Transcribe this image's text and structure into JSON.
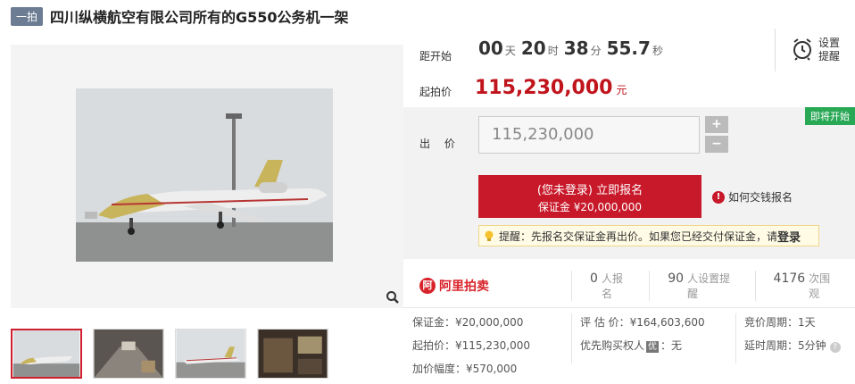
{
  "header": {
    "round_badge": "一拍",
    "title": "四川纵横航空有限公司所有的G550公务机一架"
  },
  "countdown": {
    "label": "距开始",
    "days": "00",
    "days_unit": "天",
    "hours": "20",
    "hours_unit": "时",
    "minutes": "38",
    "minutes_unit": "分",
    "seconds": "55.7",
    "seconds_unit": "秒"
  },
  "remind": {
    "line1": "设置",
    "line2": "提醒"
  },
  "start_price": {
    "label": "起拍价",
    "value": "115,230,000",
    "unit": "元"
  },
  "bid": {
    "soon_tag": "即将开始",
    "label": "出 价",
    "input_value": "115,230,000",
    "plus": "+",
    "minus": "−",
    "signup_main": "(您未登录) 立即报名",
    "signup_sub": "保证金 ¥20,000,000",
    "howto": "如何交钱报名",
    "tip_text": "提醒：先报名交保证金再出价。如果您已经交付保证金，请",
    "tip_link": "登录"
  },
  "stats": {
    "logo_text": "阿里拍卖",
    "signups_num": "0",
    "signups_unit": "人报名",
    "reminders_num": "90",
    "reminders_unit": "人设置提醒",
    "views_num": "4176",
    "views_unit": "次围观"
  },
  "details": {
    "deposit": "保证金：¥20,000,000",
    "start_price": "起拍价：¥115,230,000",
    "increment": "加价幅度：¥570,000",
    "appraisal": "评 估 价：¥164,603,600",
    "priority_label": "优先购买权人",
    "priority_badge": "优",
    "priority_value": "：无",
    "cycle": "竞价周期：1天",
    "delay": "延时周期：5分钟"
  },
  "colors": {
    "accent": "#c8192a",
    "soon": "#29a855"
  },
  "icons": [
    "alarm-clock-icon",
    "zoom-icon",
    "info-icon",
    "lightbulb-icon",
    "help-icon"
  ]
}
